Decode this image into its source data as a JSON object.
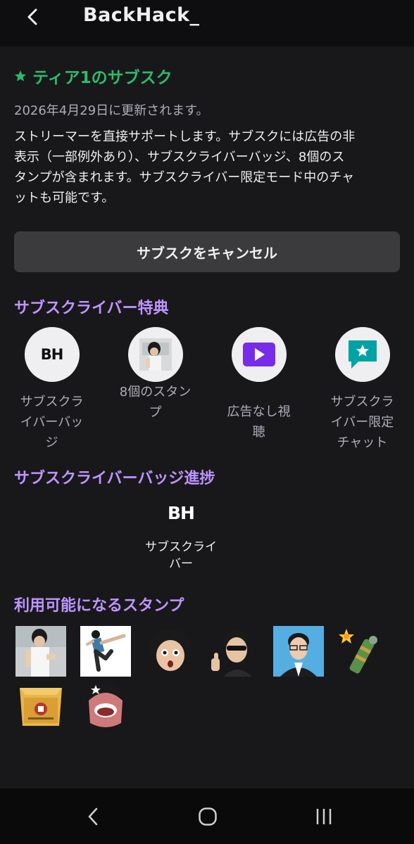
{
  "header": {
    "title": "BackHack_"
  },
  "tier": {
    "title": "ティア1のサブスク",
    "renew_text": "2026年4月29日に更新されます。",
    "description_lines": [
      "ストリーマーを直接サポートします。サブスクには広告の非",
      "表示（一部例外あり）、サブスクライバーバッジ、8個のス",
      "タンプが含まれます。サブスクライバー限定モード中のチャ",
      "ットも可能です。"
    ],
    "cancel_label": "サブスクをキャンセル"
  },
  "benefits": {
    "title": "サブスクライバー特典",
    "items": [
      {
        "icon": "bh-badge-icon",
        "label_lines": [
          "サブスクラ",
          "イバーバッ",
          "ジ"
        ]
      },
      {
        "icon": "emote-preview-icon",
        "label_lines": [
          "8個のスタン",
          "プ"
        ]
      },
      {
        "icon": "play-icon",
        "label_lines": [
          "広告なし視",
          "聴"
        ]
      },
      {
        "icon": "star-chat-icon",
        "label_lines": [
          "サブスクラ",
          "イバー限定",
          "チャット"
        ]
      }
    ]
  },
  "badge_progress": {
    "title": "サブスクライバーバッジ進捗",
    "badge_text": "BH",
    "label_lines": [
      "サブスクライ",
      "バー"
    ]
  },
  "emotes": {
    "title": "利用可能になるスタンプ",
    "count": 8
  },
  "colors": {
    "accent_purple": "#bf94ff",
    "tier_green": "#2dbb69",
    "play_purple": "#772ce8",
    "chat_teal": "#00a3a3"
  },
  "bh_logo_text": "BH"
}
